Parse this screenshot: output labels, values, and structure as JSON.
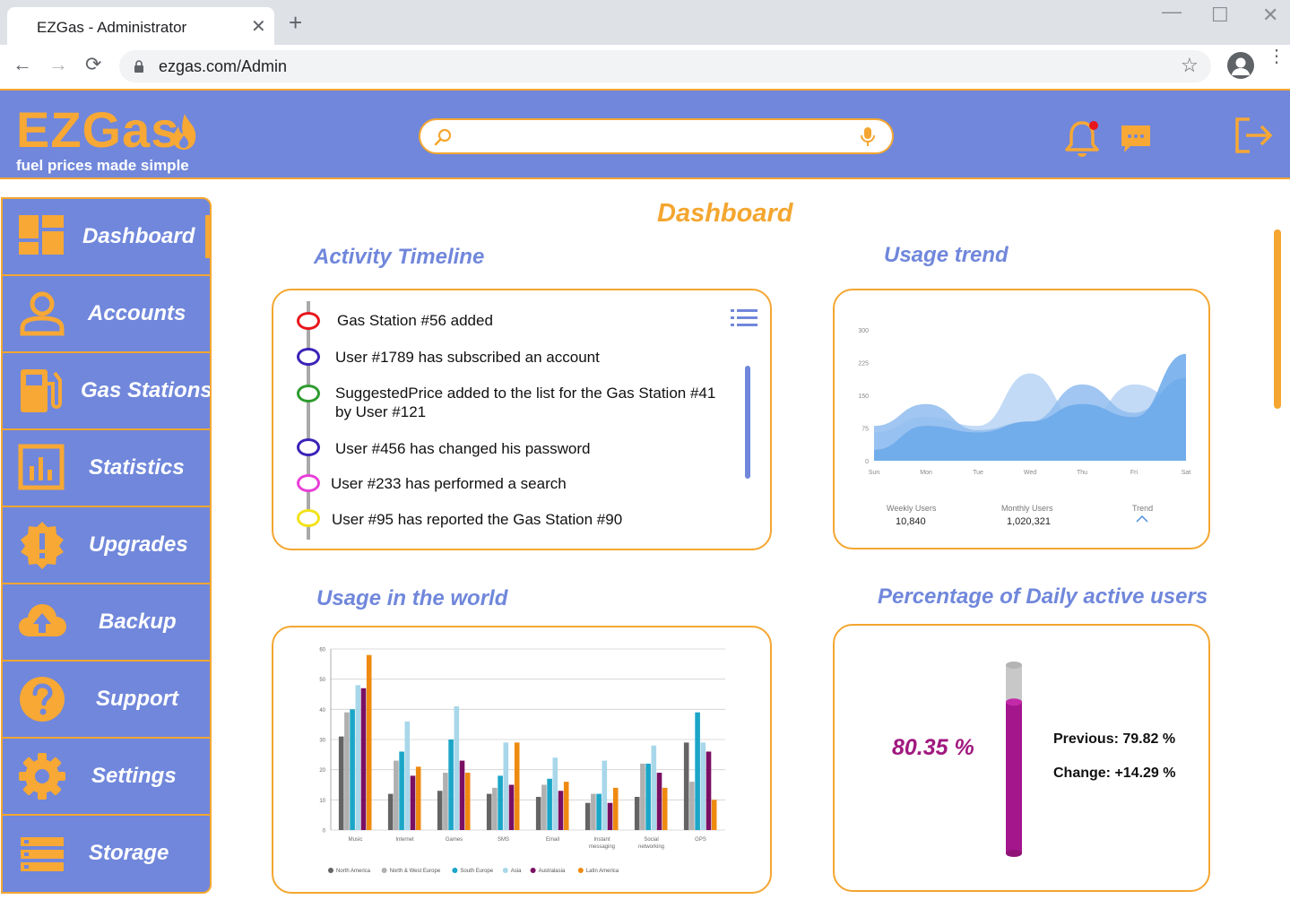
{
  "browser": {
    "tab_title": "EZGas - Administrator",
    "url": "ezgas.com/Admin"
  },
  "header": {
    "logo_text": "EZGas",
    "tagline": "fuel prices made simple",
    "search_placeholder": "",
    "colors": {
      "bar": "#7087db",
      "accent": "#f4a630",
      "notification_dot": "#e8161d"
    }
  },
  "sidebar": {
    "active": "Dashboard",
    "items": [
      {
        "label": "Dashboard",
        "icon": "dashboard-icon"
      },
      {
        "label": "Accounts",
        "icon": "user-icon"
      },
      {
        "label": "Gas Stations",
        "icon": "fuel-pump-icon"
      },
      {
        "label": "Statistics",
        "icon": "bar-chart-icon"
      },
      {
        "label": "Upgrades",
        "icon": "alert-badge-icon"
      },
      {
        "label": "Backup",
        "icon": "cloud-upload-icon"
      },
      {
        "label": "Support",
        "icon": "question-icon"
      },
      {
        "label": "Settings",
        "icon": "gear-icon"
      },
      {
        "label": "Storage",
        "icon": "storage-icon"
      }
    ]
  },
  "main": {
    "title": "Dashboard",
    "timeline": {
      "title": "Activity Timeline",
      "items": [
        {
          "text": "Gas Station #56 added",
          "color": "#e8161d"
        },
        {
          "text": "User #1789 has subscribed an account",
          "color": "#3a23b8"
        },
        {
          "text": "SuggestedPrice added to the list for the Gas Station #41 by User #121",
          "color": "#2e9b2f"
        },
        {
          "text": "User #456 has changed his password",
          "color": "#3a23b8"
        },
        {
          "text": "User #233 has performed a search",
          "color": "#ea3fd8"
        },
        {
          "text": "User #95 has reported the Gas Station #90",
          "color": "#f2e21a"
        }
      ]
    },
    "usage_trend": {
      "title": "Usage trend",
      "stats": [
        {
          "label": "Weekly Users",
          "value": "10,840"
        },
        {
          "label": "Monthly Users",
          "value": "1,020,321"
        },
        {
          "label": "Trend",
          "value": ""
        }
      ]
    },
    "world": {
      "title": "Usage in the world"
    },
    "dau": {
      "title": "Percentage of Daily active users",
      "value": "80.35 %",
      "value_fraction": 0.8035,
      "previous": "Previous: 79.82 %",
      "change": "Change: +14.29 %",
      "fill_color": "#a3168c"
    }
  },
  "chart_data": [
    {
      "type": "area",
      "categories": [
        "Sun",
        "Mon",
        "Tue",
        "Wed",
        "Thu",
        "Fri",
        "Sat"
      ],
      "ylim": [
        0,
        300
      ],
      "yticks": [
        "0",
        "75",
        "150",
        "225",
        "300"
      ],
      "series": [
        {
          "values": [
            65,
            100,
            80,
            200,
            85,
            175,
            130
          ],
          "color": "#b7d3f3"
        },
        {
          "values": [
            80,
            130,
            70,
            90,
            175,
            110,
            190
          ],
          "color": "#8fbcee"
        },
        {
          "values": [
            25,
            80,
            65,
            90,
            130,
            100,
            245
          ],
          "color": "#6aa8ea"
        }
      ]
    },
    {
      "type": "bar",
      "categories": [
        "Music",
        "Internet",
        "Games",
        "SMS",
        "Email",
        "Instant messaging",
        "Social networking",
        "GPS"
      ],
      "ylim": [
        0,
        60
      ],
      "yticks": [
        "0",
        "10",
        "20",
        "30",
        "40",
        "50",
        "60"
      ],
      "legend": "bottom",
      "series": [
        {
          "name": "North America",
          "color": "#646464",
          "values": [
            31,
            12,
            13,
            12,
            11,
            9,
            11,
            29
          ]
        },
        {
          "name": "North & West Europe",
          "color": "#b0b0b0",
          "values": [
            39,
            23,
            19,
            14,
            15,
            12,
            22,
            16
          ]
        },
        {
          "name": "South Europe",
          "color": "#1ba6c8",
          "values": [
            40,
            26,
            30,
            18,
            17,
            12,
            22,
            39
          ]
        },
        {
          "name": "Asia",
          "color": "#a8d7ea",
          "values": [
            48,
            36,
            41,
            29,
            24,
            23,
            28,
            29
          ]
        },
        {
          "name": "Australasia",
          "color": "#7a1063",
          "values": [
            47,
            18,
            23,
            15,
            13,
            9,
            19,
            26
          ]
        },
        {
          "name": "Latin America",
          "color": "#ef8a11",
          "values": [
            58,
            21,
            19,
            29,
            16,
            14,
            14,
            10
          ]
        }
      ]
    }
  ]
}
